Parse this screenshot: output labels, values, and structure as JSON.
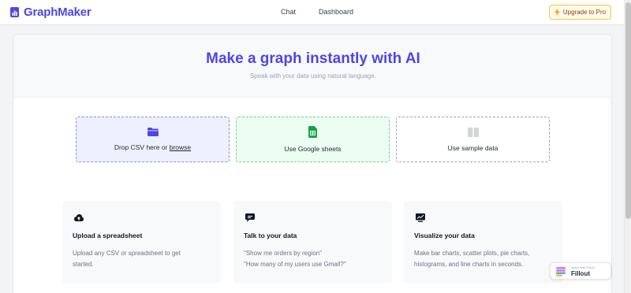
{
  "app": {
    "name": "GraphMaker"
  },
  "nav": {
    "chat": "Chat",
    "dashboard": "Dashboard",
    "upgrade": "Upgrade to Pro"
  },
  "hero": {
    "title": "Make a graph instantly with AI",
    "subtitle": "Speak with your data using natural language."
  },
  "options": {
    "csv_prefix": "Drop CSV here or ",
    "csv_link": "browse",
    "sheets": "Use Google sheets",
    "sample": "Use sample data"
  },
  "features": [
    {
      "title": "Upload a spreadsheet",
      "lines": [
        "Upload any CSV or spreadsheet to get",
        "started."
      ]
    },
    {
      "title": "Talk to your data",
      "lines": [
        "\"Show me orders by region\"",
        "\"How many of my users use Gmail?\""
      ]
    },
    {
      "title": "Visualize your data",
      "lines": [
        "Make bar charts, scatter plots, pie charts,",
        "histograms, and line charts in seconds."
      ]
    }
  ],
  "badge": {
    "small": "Made with Fillout",
    "name": "Fillout"
  },
  "colors": {
    "accent": "#4f46e5",
    "sheets_green": "#16a34a",
    "upgrade_border": "#f5c542"
  },
  "icons": [
    "bar-chart-icon",
    "lightning-icon",
    "folder-icon",
    "google-sheets-icon",
    "book-icon",
    "cloud-upload-icon",
    "chat-bubble-icon",
    "trend-chart-icon",
    "fillout-logo-icon"
  ]
}
